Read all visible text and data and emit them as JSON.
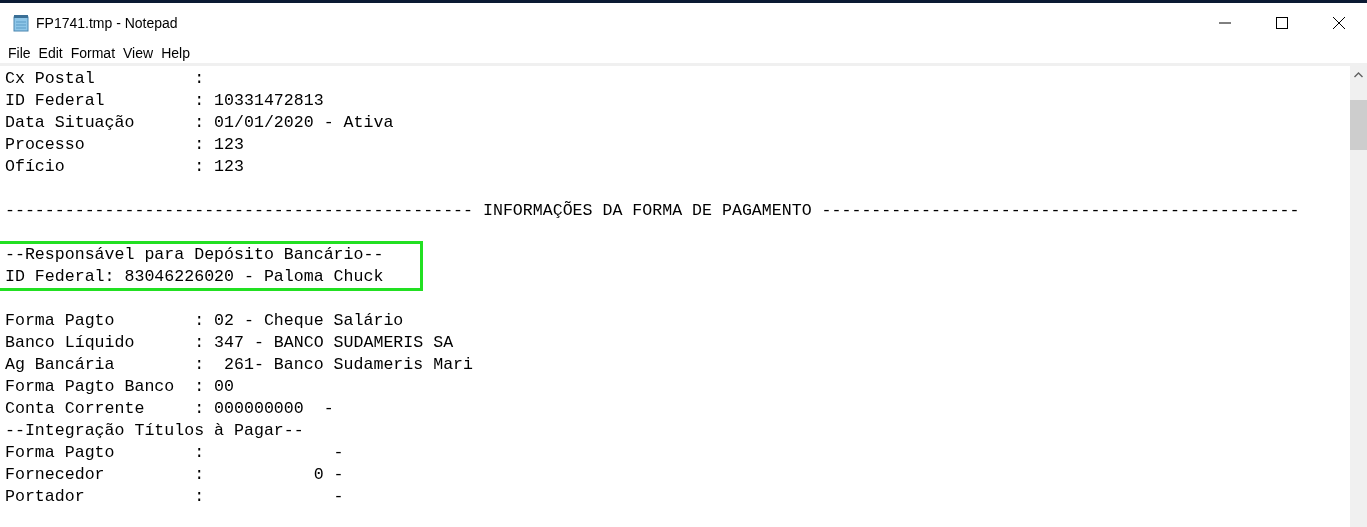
{
  "window": {
    "title": "FP1741.tmp - Notepad"
  },
  "menu": [
    "File",
    "Edit",
    "Format",
    "View",
    "Help"
  ],
  "document": [
    {
      "kind": "line",
      "text": "Cx Postal          :"
    },
    {
      "kind": "line",
      "text": "ID Federal         : 10331472813"
    },
    {
      "kind": "line",
      "text": "Data Situação      : 01/01/2020 - Ativa"
    },
    {
      "kind": "line",
      "text": "Processo           : 123"
    },
    {
      "kind": "line",
      "text": "Ofício             : 123"
    },
    {
      "kind": "blank"
    },
    {
      "kind": "line",
      "text": "----------------------------------------------- INFORMAÇÕES DA FORMA DE PAGAMENTO ------------------------------------------------"
    },
    {
      "kind": "blank"
    },
    {
      "kind": "highlight",
      "lines": [
        "--Responsável para Depósito Bancário--",
        "ID Federal: 83046226020 - Paloma Chuck"
      ]
    },
    {
      "kind": "blank"
    },
    {
      "kind": "line",
      "text": "Forma Pagto        : 02 - Cheque Salário"
    },
    {
      "kind": "line",
      "text": "Banco Líquido      : 347 - BANCO SUDAMERIS SA"
    },
    {
      "kind": "line",
      "text": "Ag Bancária        :  261- Banco Sudameris Mari"
    },
    {
      "kind": "line",
      "text": "Forma Pagto Banco  : 00"
    },
    {
      "kind": "line",
      "text": "Conta Corrente     : 000000000  -"
    },
    {
      "kind": "line",
      "text": "--Integração Títulos à Pagar--"
    },
    {
      "kind": "line",
      "text": "Forma Pagto        :             -"
    },
    {
      "kind": "line",
      "text": "Fornecedor         :           0 -"
    },
    {
      "kind": "line",
      "text": "Portador           :             -"
    }
  ]
}
